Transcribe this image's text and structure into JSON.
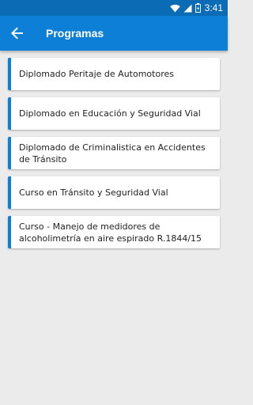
{
  "status_bar": {
    "time": "3:41",
    "icons": [
      "wifi-icon",
      "signal-icon",
      "battery-icon"
    ]
  },
  "app_bar": {
    "title": "Programas",
    "back_icon": "arrow-left-icon"
  },
  "colors": {
    "status_bar": "#0b6cb5",
    "app_bar": "#0e7fd7",
    "accent": "#0e7fd7",
    "background": "#ebebeb"
  },
  "programs": [
    {
      "label": "Diplomado Peritaje de Automotores"
    },
    {
      "label": "Diplomado en Educación y Seguridad Vial"
    },
    {
      "label": "Diplomado de Criminalistica en Accidentes de Tránsito"
    },
    {
      "label": "Curso en Tránsito y Seguridad Vial"
    },
    {
      "label": "Curso - Manejo de medidores de alcoholimetría en aire espirado R.1844/15"
    }
  ]
}
